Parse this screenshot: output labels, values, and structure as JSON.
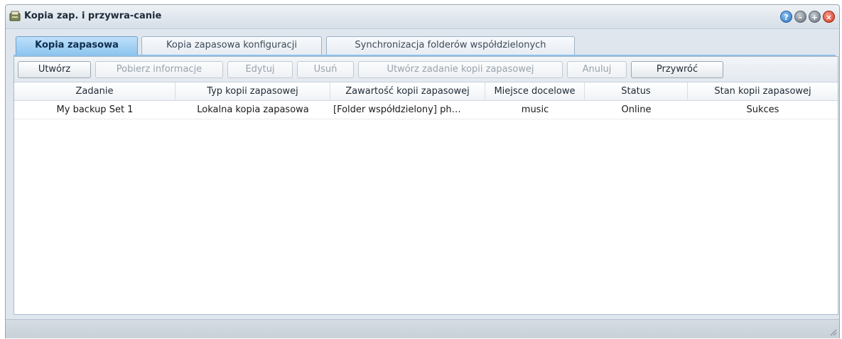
{
  "window": {
    "title": "Kopia zap. i przywra-canie",
    "app_icon": "backup-app-icon",
    "controls": [
      "help-icon",
      "minimize-icon",
      "maximize-icon",
      "close-icon"
    ]
  },
  "tabs": [
    {
      "label": "Kopia zapasowa",
      "active": true
    },
    {
      "label": "Kopia zapasowa konfiguracji",
      "active": false
    },
    {
      "label": "Synchronizacja folderów współdzielonych",
      "active": false
    }
  ],
  "toolbar": {
    "create": "Utwórz",
    "get_info": "Pobierz informacje",
    "edit": "Edytuj",
    "delete": "Usuń",
    "create_backup_task": "Utwórz zadanie kopii zapasowej",
    "cancel": "Anuluj",
    "restore": "Przywróć"
  },
  "table": {
    "columns": [
      "Zadanie",
      "Typ kopii zapasowej",
      "Zawartość kopii zapasowej",
      "Miejsce docelowe",
      "Status",
      "Stan kopii zapasowej"
    ],
    "rows": [
      [
        "My backup Set 1",
        "Lokalna kopia zapasowa",
        "[Folder współdzielony] ph…",
        "music",
        "Online",
        "Sukces"
      ]
    ]
  },
  "colors": {
    "active_tab": "#8ec5ef",
    "window_bg": "#dfe6ee",
    "close_button": "#d4351d",
    "help_button": "#2a74c7"
  }
}
